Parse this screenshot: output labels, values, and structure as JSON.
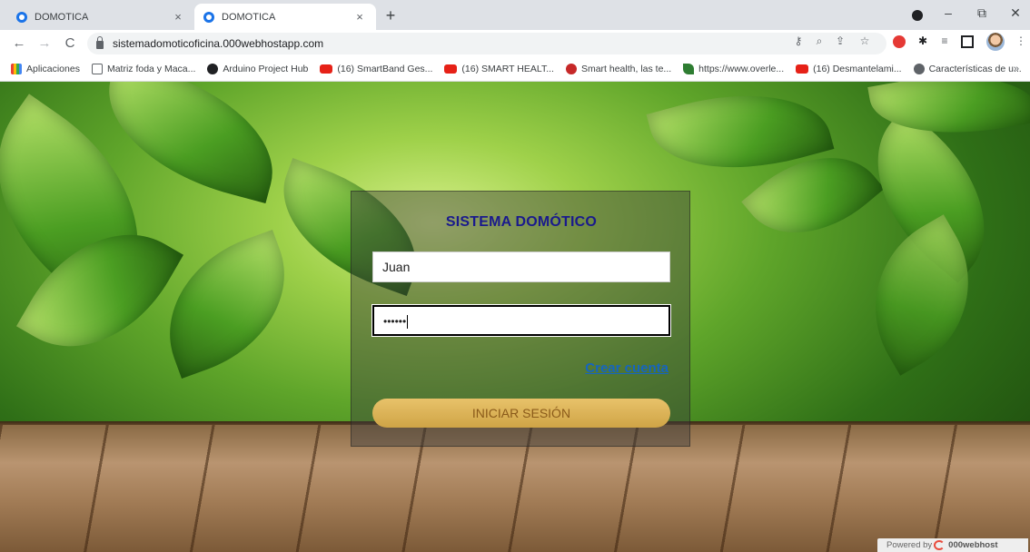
{
  "browser": {
    "tabs": [
      {
        "title": "DOMOTICA",
        "close": "×"
      },
      {
        "title": "DOMOTICA",
        "close": "×"
      }
    ],
    "new_tab": "+",
    "window_controls": {
      "minimize": "–",
      "maximize": "⧉",
      "close": "✕"
    },
    "nav": {
      "back": "←",
      "forward": "→",
      "reload": "C"
    },
    "url": "sistemadomoticoficina.000webhostapp.com",
    "bookmarks": [
      {
        "label": "Aplicaciones",
        "icon": "apps-grid-icon",
        "color": "#ea4335"
      },
      {
        "label": "Matriz foda y Maca...",
        "icon": "e-icon",
        "color": "#5f6368"
      },
      {
        "label": "Arduino Project Hub",
        "icon": "arduino-icon",
        "color": "#202124"
      },
      {
        "label": "(16) SmartBand Ges...",
        "icon": "youtube-icon",
        "color": "#e62117"
      },
      {
        "label": "(16) SMART HEALT...",
        "icon": "youtube-icon",
        "color": "#e62117"
      },
      {
        "label": "Smart health, las te...",
        "icon": "site-icon",
        "color": "#c62828"
      },
      {
        "label": "https://www.overle...",
        "icon": "overleaf-icon",
        "color": "#2e7d32"
      },
      {
        "label": "(16) Desmantelami...",
        "icon": "youtube-icon",
        "color": "#e62117"
      },
      {
        "label": "Características de u...",
        "icon": "globe-icon",
        "color": "#5f6368"
      }
    ],
    "bookmarks_more": "»"
  },
  "login": {
    "title": "SISTEMA DOMÓTICO",
    "username_value": "Juan",
    "password_value": "••••••",
    "create_account": "Crear cuenta",
    "submit": "INICIAR SESIÓN"
  },
  "footer": {
    "powered_by": "Powered by",
    "brand": "000webhost"
  },
  "colors": {
    "title": "#1a1a8c",
    "link": "#1565c0",
    "button": "#d9b25a",
    "button_text": "#8a5a1a"
  }
}
